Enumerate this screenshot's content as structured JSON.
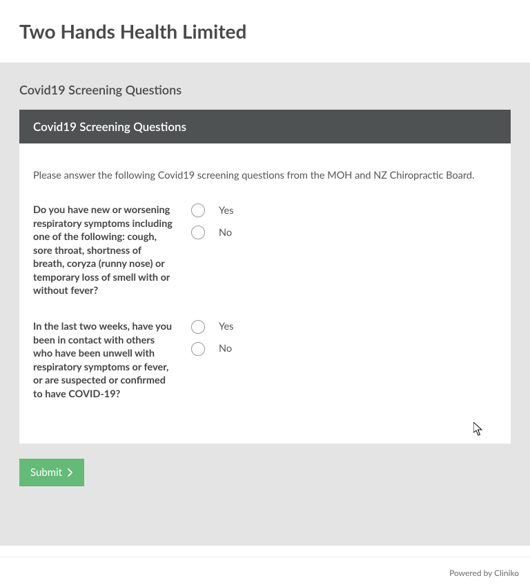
{
  "header": {
    "company": "Two Hands Health Limited"
  },
  "page": {
    "section_title": "Covid19 Screening Questions",
    "form_header": "Covid19 Screening Questions",
    "intro": "Please answer the following Covid19 screening questions from the MOH and NZ Chiropractic Board.",
    "questions": [
      {
        "text": "Do you have new or worsening respiratory symptoms including one of the following: cough, sore throat, shortness of breath, coryza (runny nose) or temporary loss of smell with or without fever?",
        "options": [
          "Yes",
          "No"
        ]
      },
      {
        "text": "In the last two weeks, have you been in contact with others who have been unwell with respiratory symptoms or fever, or are suspected or confirmed to have COVID-19?",
        "options": [
          "Yes",
          "No"
        ]
      }
    ],
    "submit_label": "Submit"
  },
  "footer": {
    "powered_by": "Powered by Cliniko"
  }
}
